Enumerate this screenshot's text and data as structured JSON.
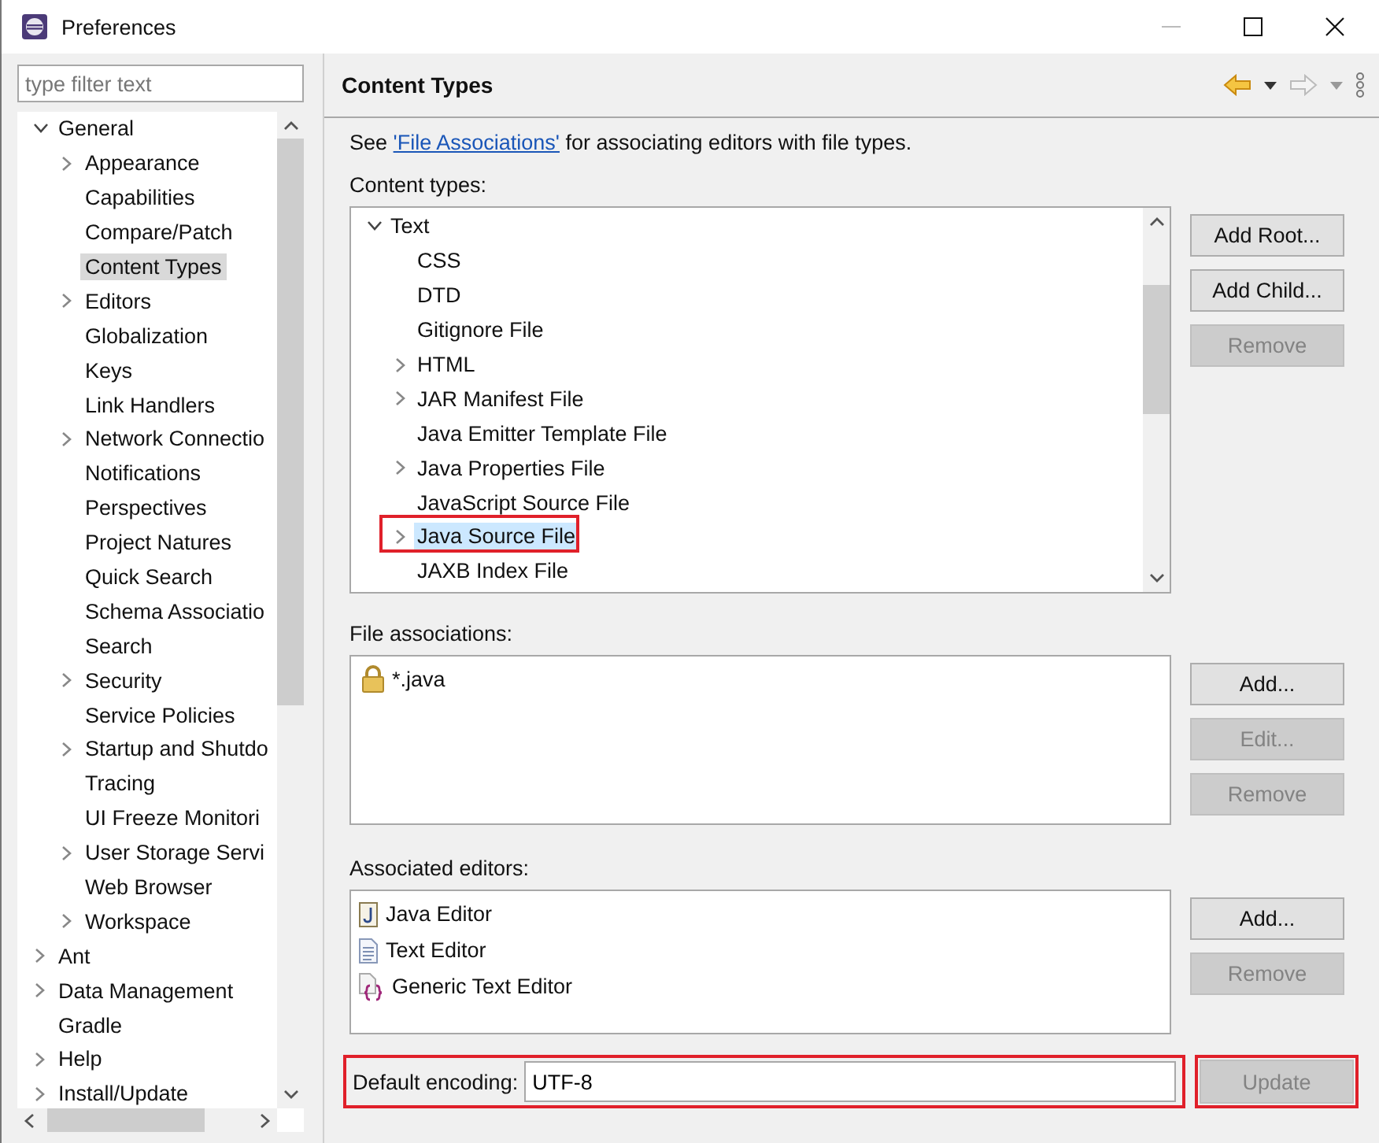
{
  "window": {
    "title": "Preferences"
  },
  "filter": {
    "placeholder": "type filter text"
  },
  "tree": [
    {
      "label": "General",
      "expanded": true,
      "selected": false,
      "children": [
        {
          "label": "Appearance",
          "expanded": false,
          "selected": false
        },
        {
          "label": "Capabilities",
          "selected": false
        },
        {
          "label": "Compare/Patch",
          "selected": false
        },
        {
          "label": "Content Types",
          "selected": true
        },
        {
          "label": "Editors",
          "expanded": false,
          "selected": false
        },
        {
          "label": "Globalization",
          "selected": false
        },
        {
          "label": "Keys",
          "selected": false
        },
        {
          "label": "Link Handlers",
          "selected": false
        },
        {
          "label": "Network Connectio",
          "expanded": false,
          "selected": false
        },
        {
          "label": "Notifications",
          "selected": false
        },
        {
          "label": "Perspectives",
          "selected": false
        },
        {
          "label": "Project Natures",
          "selected": false
        },
        {
          "label": "Quick Search",
          "selected": false
        },
        {
          "label": "Schema Associatio",
          "selected": false
        },
        {
          "label": "Search",
          "selected": false
        },
        {
          "label": "Security",
          "expanded": false,
          "selected": false
        },
        {
          "label": "Service Policies",
          "selected": false
        },
        {
          "label": "Startup and Shutdo",
          "expanded": false,
          "selected": false
        },
        {
          "label": "Tracing",
          "selected": false
        },
        {
          "label": "UI Freeze Monitori",
          "selected": false
        },
        {
          "label": "User Storage Servi",
          "expanded": false,
          "selected": false
        },
        {
          "label": "Web Browser",
          "selected": false
        },
        {
          "label": "Workspace",
          "expanded": false,
          "selected": false
        }
      ]
    },
    {
      "label": "Ant",
      "expanded": false,
      "selected": false
    },
    {
      "label": "Data Management",
      "expanded": false,
      "selected": false
    },
    {
      "label": "Gradle",
      "selected": false
    },
    {
      "label": "Help",
      "expanded": false,
      "selected": false
    },
    {
      "label": "Install/Update",
      "expanded": false,
      "selected": false
    }
  ],
  "page": {
    "title": "Content Types",
    "intro": {
      "before": "See",
      "link": "'File Associations'",
      "after": "for associating editors with file types."
    },
    "content_types": {
      "label": "Content types:",
      "items": [
        {
          "label": "Text",
          "expanded": true,
          "selected": false,
          "highlighted": false,
          "children": [
            {
              "label": "CSS",
              "selected": false,
              "highlighted": false
            },
            {
              "label": "DTD",
              "selected": false,
              "highlighted": false
            },
            {
              "label": "Gitignore File",
              "selected": false,
              "highlighted": false
            },
            {
              "label": "HTML",
              "expanded": false,
              "selected": false,
              "highlighted": false
            },
            {
              "label": "JAR Manifest File",
              "expanded": false,
              "selected": false,
              "highlighted": false
            },
            {
              "label": "Java Emitter Template File",
              "selected": false,
              "highlighted": false
            },
            {
              "label": "Java Properties File",
              "expanded": false,
              "selected": false,
              "highlighted": false
            },
            {
              "label": "JavaScript Source File",
              "selected": false,
              "highlighted": false
            },
            {
              "label": "Java Source File",
              "expanded": false,
              "selected": true,
              "highlighted": true
            },
            {
              "label": "JAXB Index File",
              "selected": false,
              "highlighted": false
            }
          ]
        }
      ],
      "buttons": [
        {
          "label": "Add Root...",
          "disabled": false
        },
        {
          "label": "Add Child...",
          "disabled": false
        },
        {
          "label": "Remove",
          "disabled": true
        }
      ]
    },
    "file_associations": {
      "label": "File associations:",
      "items": [
        {
          "label": "*.java",
          "kind": "locked"
        }
      ],
      "buttons": [
        {
          "label": "Add...",
          "disabled": false
        },
        {
          "label": "Edit...",
          "disabled": true
        },
        {
          "label": "Remove",
          "disabled": true
        }
      ]
    },
    "associated_editors": {
      "label": "Associated editors:",
      "items": [
        {
          "label": "Java Editor",
          "kind": "java"
        },
        {
          "label": "Text Editor",
          "kind": "text"
        },
        {
          "label": "Generic Text Editor",
          "kind": "generic"
        }
      ],
      "buttons": [
        {
          "label": "Add...",
          "disabled": false
        },
        {
          "label": "Remove",
          "disabled": true
        }
      ]
    },
    "encoding": {
      "label": "Default encoding:",
      "value": "UTF-8",
      "highlighted": true,
      "button": {
        "label": "Update",
        "disabled": true,
        "highlighted": true
      }
    }
  }
}
